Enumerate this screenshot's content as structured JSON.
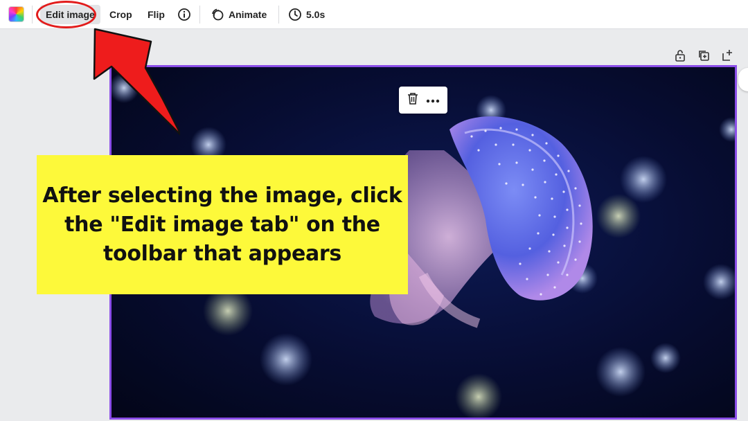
{
  "toolbar": {
    "edit_image_label": "Edit image",
    "crop_label": "Crop",
    "flip_label": "Flip",
    "animate_label": "Animate",
    "duration_label": "5.0s",
    "icons": [
      "color-swatch",
      "info-icon",
      "animate-icon",
      "clock-icon"
    ]
  },
  "canvas": {
    "icons": [
      "lock-icon",
      "duplicate-icon",
      "add-page-icon"
    ]
  },
  "float_tools": {
    "icons": [
      "trash-icon",
      "more-icon"
    ]
  },
  "callout": {
    "text": "After selecting the image, click the \"Edit image tab\" on the toolbar that appears"
  },
  "colors": {
    "accent_selection": "#8b4ee8",
    "callout_bg": "#fdf93a",
    "annotation_red": "#e21c1c"
  }
}
